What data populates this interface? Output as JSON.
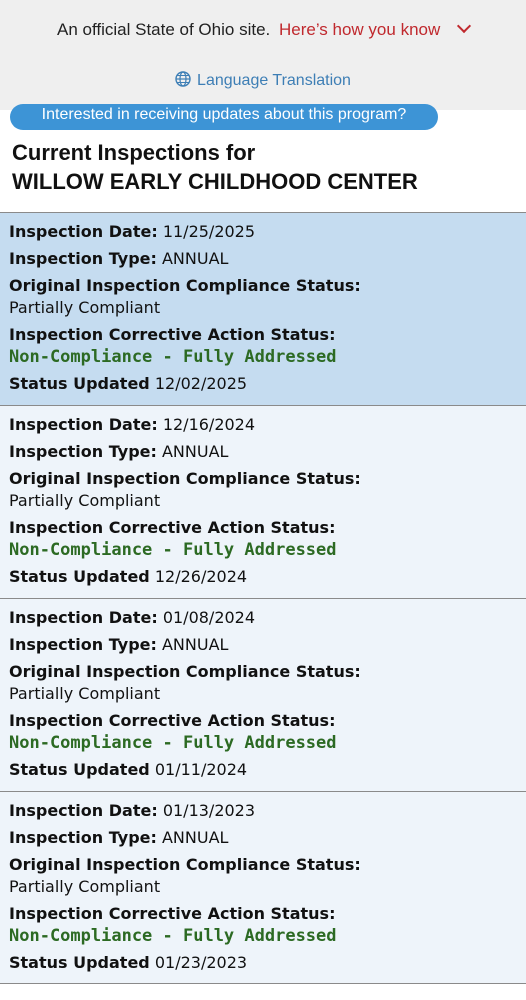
{
  "gov_banner": {
    "official_text": "An official State of Ohio site.",
    "how_know_link": "Here’s how you know",
    "language_link": "Language Translation"
  },
  "updates_button": "Interested in receiving updates about this program?",
  "page_title": {
    "line1": "Current Inspections for",
    "line2": "WILLOW EARLY CHILDHOOD CENTER"
  },
  "labels": {
    "inspection_date": "Inspection Date:",
    "inspection_type": "Inspection Type:",
    "original_status": "Original Inspection Compliance Status:",
    "corrective_status": "Inspection Corrective Action Status:",
    "status_updated": "Status Updated"
  },
  "inspections": [
    {
      "date": "11/25/2025",
      "type": "ANNUAL",
      "original_status": "Partially Compliant",
      "corrective_status": "Non-Compliance - Fully Addressed",
      "status_updated": "12/02/2025"
    },
    {
      "date": "12/16/2024",
      "type": "ANNUAL",
      "original_status": "Partially Compliant",
      "corrective_status": "Non-Compliance - Fully Addressed",
      "status_updated": "12/26/2024"
    },
    {
      "date": "01/08/2024",
      "type": "ANNUAL",
      "original_status": "Partially Compliant",
      "corrective_status": "Non-Compliance - Fully Addressed",
      "status_updated": "01/11/2024"
    },
    {
      "date": "01/13/2023",
      "type": "ANNUAL",
      "original_status": "Partially Compliant",
      "corrective_status": "Non-Compliance - Fully Addressed",
      "status_updated": "01/23/2023"
    }
  ],
  "colors": {
    "banner_bg": "#efefef",
    "link_red": "#c0292e",
    "link_blue": "#3d7eb5",
    "pill_blue": "#3d94d6",
    "current_card_bg": "#c5dcf0",
    "card_bg": "#eef4fa",
    "status_green": "#2c6a23"
  },
  "icons": {
    "chevron": "chevron-down-icon",
    "globe": "globe-icon"
  }
}
